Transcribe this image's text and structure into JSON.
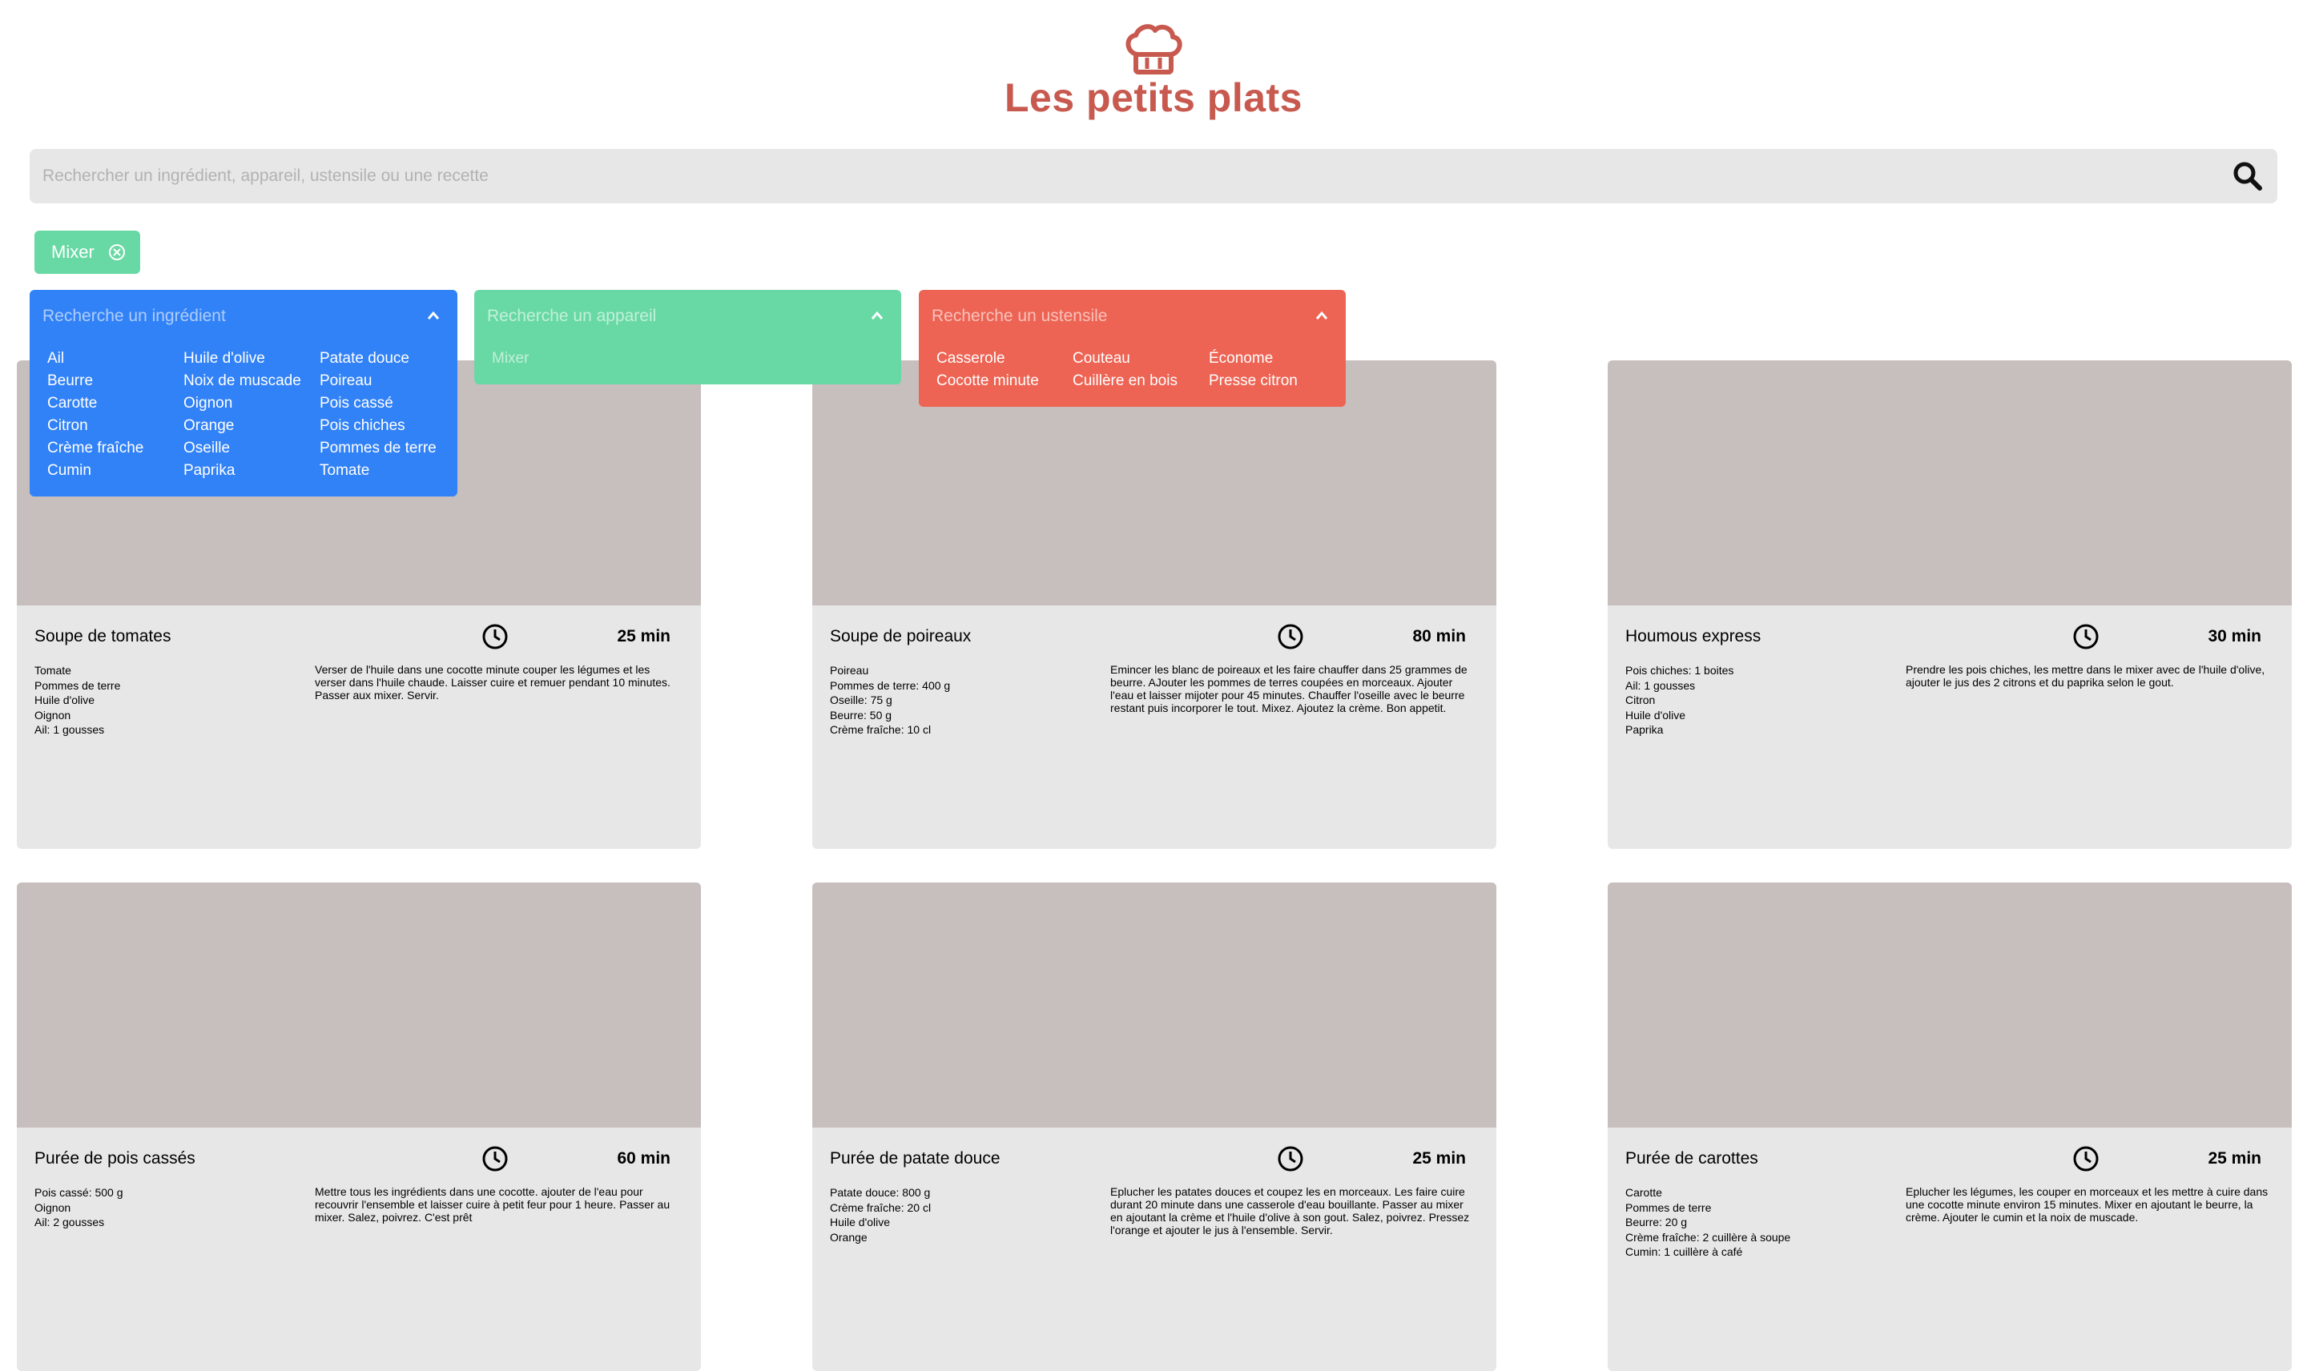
{
  "header": {
    "logo_icon": "chef-hat-icon",
    "title": "Les petits plats",
    "brand_color": "#c7594f"
  },
  "search": {
    "placeholder": "Rechercher un ingrédient, appareil, ustensile ou une recette",
    "value": "",
    "icon": "search-icon"
  },
  "tags": [
    {
      "label": "Mixer",
      "type": "appareil",
      "color": "#68d9a4"
    }
  ],
  "filters": {
    "ingredients": {
      "placeholder": "Recherche un ingrédient",
      "color": "#3282f7",
      "items": [
        "Ail",
        "Beurre",
        "Carotte",
        "Citron",
        "Crème fraîche",
        "Cumin",
        "Huile d'olive",
        "Noix de muscade",
        "Oignon",
        "Orange",
        "Oseille",
        "Paprika",
        "Patate douce",
        "Poireau",
        "Pois cassé",
        "Pois chiches",
        "Pommes de terre",
        "Tomate"
      ]
    },
    "appareils": {
      "placeholder": "Recherche un appareil",
      "color": "#68d9a4",
      "items": [
        "Mixer"
      ]
    },
    "ustensiles": {
      "placeholder": "Recherche un ustensile",
      "color": "#ed6454",
      "items": [
        "Casserole",
        "Cocotte minute",
        "Couteau",
        "Cuillère en bois",
        "Économe",
        "Presse citron"
      ]
    }
  },
  "recipes": [
    {
      "name": "Soupe de tomates",
      "time": "25 min",
      "ingredients": [
        "Tomate",
        "Pommes de terre",
        "Huile d'olive",
        "Oignon",
        "Ail: 1 gousses"
      ],
      "description": "Verser de l'huile dans une cocotte minute couper les légumes et les verser dans l'huile chaude. Laisser cuire et remuer pendant 10 minutes. Passer aux mixer. Servir."
    },
    {
      "name": "Soupe de poireaux",
      "time": "80 min",
      "ingredients": [
        "Poireau",
        "Pommes de terre: 400 g",
        "Oseille: 75 g",
        "Beurre: 50 g",
        "Crème fraîche: 10 cl"
      ],
      "description": "Emincer les blanc de poireaux et les faire chauffer dans 25 grammes de beurre. AJouter les pommes de terres coupées en morceaux. Ajouter l'eau et laisser mijoter pour 45 minutes. Chauffer l'oseille avec le beurre restant puis incorporer le tout. Mixez. Ajoutez la crème. Bon appetit."
    },
    {
      "name": "Houmous express",
      "time": "30 min",
      "ingredients": [
        "Pois chiches: 1 boites",
        "Ail: 1 gousses",
        "Citron",
        "Huile d'olive",
        "Paprika"
      ],
      "description": "Prendre les pois chiches, les mettre dans le mixer avec de l'huile d'olive, ajouter le jus des 2 citrons et du paprika selon le gout."
    },
    {
      "name": "Purée de pois cassés",
      "time": "60 min",
      "ingredients": [
        "Pois cassé: 500 g",
        "Oignon",
        "Ail: 2 gousses"
      ],
      "description": "Mettre tous les ingrédients dans une cocotte. ajouter de l'eau pour recouvrir l'ensemble et laisser cuire à petit feur pour 1 heure. Passer au mixer. Salez, poivrez. C'est prêt"
    },
    {
      "name": "Purée de patate douce",
      "time": "25 min",
      "ingredients": [
        "Patate douce: 800 g",
        "Crème fraîche: 20 cl",
        "Huile d'olive",
        "Orange"
      ],
      "description": "Eplucher les patates douces et coupez les en morceaux. Les faire cuire durant 20 minute dans une casserole d'eau bouillante. Passer au mixer en ajoutant la crème et l'huile d'olive à son gout. Salez, poivrez. Pressez l'orange et ajouter le jus à l'ensemble. Servir."
    },
    {
      "name": "Purée de carottes",
      "time": "25 min",
      "ingredients": [
        "Carotte",
        "Pommes de terre",
        "Beurre: 20 g",
        "Crème fraîche: 2 cuillère à soupe",
        "Cumin: 1 cuillère à café"
      ],
      "description": "Eplucher les légumes, les couper en morceaux et les mettre à cuire dans une cocotte minute environ 15 minutes. Mixer en ajoutant le beurre, la crème. Ajouter le cumin et la noix de muscade."
    }
  ],
  "icons": {
    "clock": "clock-icon",
    "close": "close-circle-icon",
    "chevron": "chevron-up-icon"
  }
}
